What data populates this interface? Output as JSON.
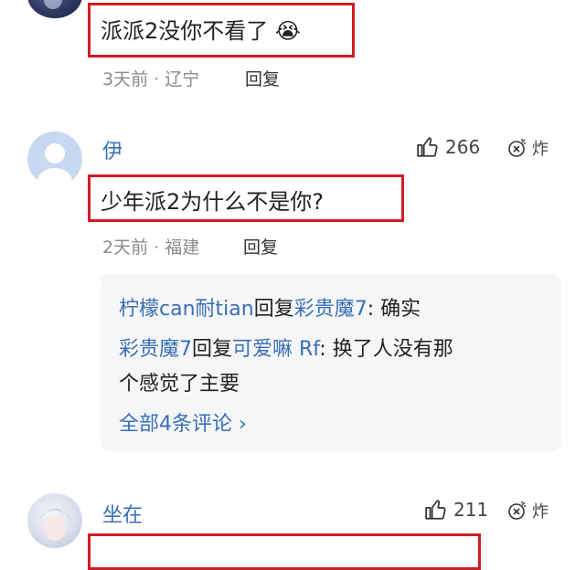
{
  "comments": [
    {
      "text": "派派2没你不看了",
      "emoji": "😭",
      "meta": "3天前 · 辽宁",
      "reply_label": "回复"
    },
    {
      "username": "伊",
      "text": "少年派2为什么不是你?",
      "meta": "2天前 · 福建",
      "reply_label": "回复",
      "likes": "266",
      "action_label": "炸",
      "replies": [
        {
          "user": "柠檬can耐tian",
          "verb": "回复",
          "target": "彩贵魔7",
          "colon": ":",
          "text": "确实"
        },
        {
          "user": "彩贵魔7",
          "verb": "回复",
          "target": "可爱嘛 Rf",
          "colon": ":",
          "text": "换了人没有那",
          "text_cont": "个感觉了主要"
        }
      ],
      "view_all": "全部4条评论 ›"
    },
    {
      "username": "坐在",
      "likes": "211",
      "action_label": "炸"
    }
  ],
  "colors": {
    "highlight_border": "#cf1d23",
    "username": "#3a6fb4",
    "meta": "#8a8a8a",
    "reply_background": "#f5f6f8"
  },
  "icons": [
    "thumbs-up-icon",
    "bomb-icon",
    "default-avatar-icon"
  ]
}
